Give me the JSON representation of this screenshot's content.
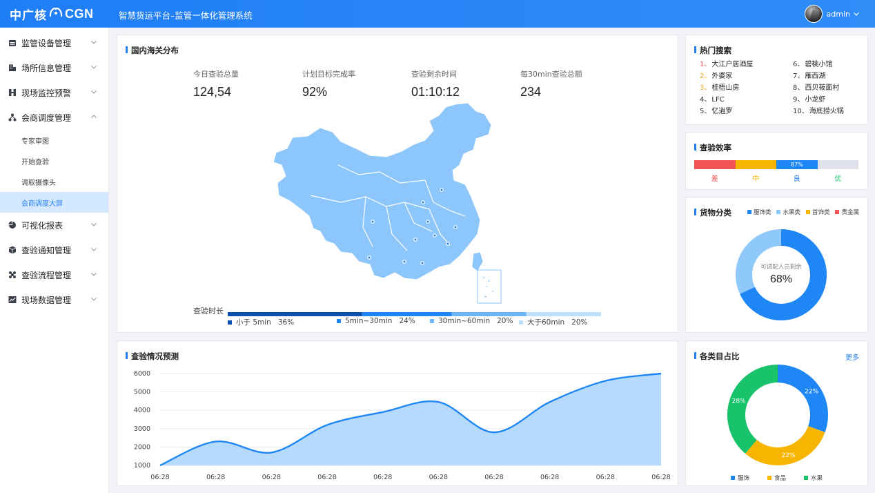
{
  "header": {
    "logo_cn": "中广核",
    "logo_en": "CGN",
    "app_title": "智慧货运平台–监管一体化管理系统",
    "user_name": "admin"
  },
  "sidebar": {
    "items": [
      {
        "label": "监管设备管理",
        "icon": "calendar-icon"
      },
      {
        "label": "场所信息管理",
        "icon": "building-icon"
      },
      {
        "label": "现场监控预警",
        "icon": "monitor-icon"
      },
      {
        "label": "会商调度管理",
        "icon": "network-icon"
      },
      {
        "label": "可视化报表",
        "icon": "pie-icon"
      },
      {
        "label": "查验通知管理",
        "icon": "cube-icon"
      },
      {
        "label": "查验流程管理",
        "icon": "flow-icon"
      },
      {
        "label": "现场数据管理",
        "icon": "chart-icon"
      }
    ],
    "sub_items": [
      "专家审图",
      "开始查验",
      "调取摄像头",
      "会商调度大屏"
    ],
    "active_sub": "会商调度大屏"
  },
  "map_panel": {
    "title": "国内海关分布",
    "stats": [
      {
        "label": "今日查验总量",
        "value": "124,54"
      },
      {
        "label": "计划目标完成率",
        "value": "92%"
      },
      {
        "label": "查验剩余时间",
        "value": "01:10:12"
      },
      {
        "label": "每30min查验总额",
        "value": "234"
      }
    ],
    "duration_label": "查验时长",
    "duration": [
      {
        "label": "小于 5min",
        "pct": "36%",
        "value": 36,
        "color": "#0a4fb0"
      },
      {
        "label": "5min~30min",
        "pct": "24%",
        "value": 24,
        "color": "#1f87f5"
      },
      {
        "label": "30min~60min",
        "pct": "20%",
        "value": 20,
        "color": "#6cb5fa"
      },
      {
        "label": "大于60min",
        "pct": "20%",
        "value": 20,
        "color": "#bfe0fd"
      }
    ]
  },
  "hot_search": {
    "title": "热门搜索",
    "items": [
      {
        "rank": "1、",
        "name": "大江户居酒屋",
        "color": "#f04a4a"
      },
      {
        "rank": "6、",
        "name": "碧桃小馆",
        "color": "#333333"
      },
      {
        "rank": "2、",
        "name": "外婆家",
        "color": "#f5a623"
      },
      {
        "rank": "7、",
        "name": "雁西湖",
        "color": "#333333"
      },
      {
        "rank": "3、",
        "name": "桂梧山房",
        "color": "#f5a623"
      },
      {
        "rank": "8、",
        "name": "西贝莜面村",
        "color": "#333333"
      },
      {
        "rank": "4、",
        "name": "LFC",
        "color": "#333333"
      },
      {
        "rank": "9、",
        "name": "小龙虾",
        "color": "#333333"
      },
      {
        "rank": "5、",
        "name": "忆逍罗",
        "color": "#333333"
      },
      {
        "rank": "10、",
        "name": "海底捞火锅",
        "color": "#333333"
      }
    ]
  },
  "efficiency": {
    "title": "查验效率",
    "segments": [
      {
        "label": "差",
        "color": "#f25252",
        "label_color": "#f25252",
        "show": ""
      },
      {
        "label": "中",
        "color": "#f7b500",
        "label_color": "#f7b500",
        "show": ""
      },
      {
        "label": "良",
        "color": "#1f87f5",
        "label_color": "#1f87f5",
        "show": "87%"
      },
      {
        "label": "优",
        "color": "#dfe2e8",
        "label_color": "#18c36b",
        "show": ""
      }
    ]
  },
  "goods": {
    "title": "货物分类",
    "legend": [
      {
        "label": "服饰类",
        "color": "#1f87f5"
      },
      {
        "label": "水果类",
        "color": "#8fc8fb"
      },
      {
        "label": "首饰类",
        "color": "#f7b500"
      },
      {
        "label": "贵金属",
        "color": "#f25252"
      }
    ],
    "center_label": "可调配人员剩余",
    "center_value": "68%",
    "value": 68
  },
  "categories": {
    "title": "各类目占比",
    "more": "更多",
    "legend": [
      {
        "label": "服饰",
        "color": "#1f87f5"
      },
      {
        "label": "食品",
        "color": "#f7b500"
      },
      {
        "label": "水果",
        "color": "#18c36b"
      }
    ]
  },
  "chart_data": [
    {
      "type": "line",
      "title": "查验情况预测",
      "x": [
        "06:28",
        "06:28",
        "06:28",
        "06:28",
        "06:28",
        "06:28",
        "06:28",
        "06:28",
        "06:28",
        "06:28"
      ],
      "series": [
        {
          "values": [
            1000,
            2300,
            1700,
            3200,
            3900,
            4450,
            2800,
            4450,
            5600,
            6000
          ]
        }
      ],
      "yticks": [
        1000,
        2000,
        3000,
        4000,
        5000,
        6000
      ],
      "ylim": [
        1000,
        6000
      ],
      "grid": true,
      "area": true,
      "color": "#1f87f5"
    },
    {
      "type": "pie",
      "title": "各类目占比",
      "categories": [
        "服饰",
        "食品",
        "水果"
      ],
      "values": [
        22,
        22,
        28
      ],
      "labels": [
        "22%",
        "22%",
        "28%"
      ],
      "colors": [
        "#1f87f5",
        "#f7b500",
        "#18c36b"
      ]
    }
  ]
}
